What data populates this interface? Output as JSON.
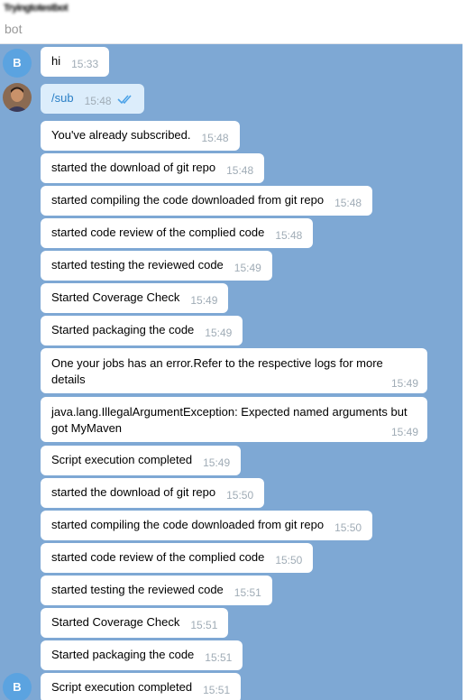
{
  "header": {
    "chat_name": "Tryingtotestbot",
    "status": "bot"
  },
  "bot_avatar": {
    "letter": "B",
    "color": "#5ba3e0"
  },
  "colors": {
    "chat_background": "#7ea8d4",
    "incoming_bubble": "#ffffff",
    "outgoing_bubble": "#dcedfb",
    "outgoing_text": "#2a7fc6",
    "time_text": "#a0acb6",
    "read_check": "#4da3e8"
  },
  "messages": [
    {
      "text": "hi",
      "time": "15:33"
    },
    {
      "text": "/sub",
      "time": "15:48",
      "read_icon": "double-check-icon"
    },
    {
      "text": "You've already subscribed.",
      "time": "15:48"
    },
    {
      "text": "started the download of git repo",
      "time": "15:48"
    },
    {
      "text": "started compiling the code downloaded from git repo",
      "time": "15:48"
    },
    {
      "text": "started code review of the complied code",
      "time": "15:48"
    },
    {
      "text": "started testing the reviewed code",
      "time": "15:49"
    },
    {
      "text": "Started Coverage Check",
      "time": "15:49"
    },
    {
      "text": "Started packaging the code",
      "time": "15:49"
    },
    {
      "text": "One your jobs has an error.Refer to the respective logs for more details",
      "time": "15:49"
    },
    {
      "text": "java.lang.IllegalArgumentException: Expected named arguments but got MyMaven",
      "time": "15:49"
    },
    {
      "text": "Script execution completed",
      "time": "15:49"
    },
    {
      "text": "started the download of git repo",
      "time": "15:50"
    },
    {
      "text": "started compiling the code downloaded from git repo",
      "time": "15:50"
    },
    {
      "text": "started code review of the complied code",
      "time": "15:50"
    },
    {
      "text": "started testing the reviewed code",
      "time": "15:51"
    },
    {
      "text": "Started Coverage Check",
      "time": "15:51"
    },
    {
      "text": "Started packaging the code",
      "time": "15:51"
    },
    {
      "text": "Script execution completed",
      "time": "15:51"
    }
  ]
}
